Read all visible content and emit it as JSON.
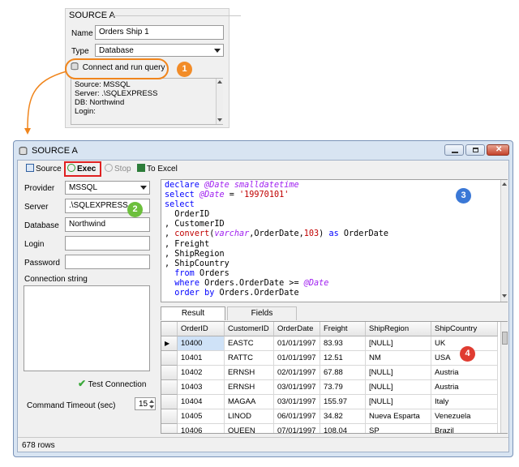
{
  "source_panel": {
    "title": "SOURCE A",
    "name_label": "Name",
    "name_value": "Orders Ship 1",
    "type_label": "Type",
    "type_value": "Database",
    "connect_button": "Connect and run query",
    "info_lines": [
      "Source: MSSQL",
      "Server: .\\SQLEXPRESS",
      "DB: Northwind",
      "Login:"
    ]
  },
  "window": {
    "title": "SOURCE A",
    "toolbar": {
      "source": "Source",
      "exec": "Exec",
      "stop": "Stop",
      "to_excel": "To Excel"
    },
    "left": {
      "provider_label": "Provider",
      "provider_value": "MSSQL",
      "server_label": "Server",
      "server_value": ".\\SQLEXPRESS",
      "database_label": "Database",
      "database_value": "Northwind",
      "login_label": "Login",
      "login_value": "",
      "password_label": "Password",
      "password_value": "",
      "conn_string_label": "Connection string",
      "conn_string_value": "",
      "test_connection": "Test Connection",
      "timeout_label": "Command Timeout (sec)",
      "timeout_value": "15"
    },
    "code_lines": [
      [
        {
          "t": "declare ",
          "c": "kw"
        },
        {
          "t": "@Date smalldatetime",
          "c": "vr"
        }
      ],
      [
        {
          "t": "select ",
          "c": "kw"
        },
        {
          "t": "@Date",
          "c": "vr"
        },
        {
          "t": " = ",
          "c": ""
        },
        {
          "t": "'19970101'",
          "c": "st"
        }
      ],
      [
        {
          "t": "select",
          "c": "kw"
        }
      ],
      [
        {
          "t": "  OrderID",
          "c": ""
        }
      ],
      [
        {
          "t": ", CustomerID",
          "c": ""
        }
      ],
      [
        {
          "t": ", ",
          "c": ""
        },
        {
          "t": "convert",
          "c": "fn"
        },
        {
          "t": "(",
          "c": ""
        },
        {
          "t": "varchar",
          "c": "ty"
        },
        {
          "t": ",OrderDate,",
          "c": ""
        },
        {
          "t": "103",
          "c": "st"
        },
        {
          "t": ") ",
          "c": ""
        },
        {
          "t": "as",
          "c": "kw"
        },
        {
          "t": " OrderDate",
          "c": ""
        }
      ],
      [
        {
          "t": ", Freight",
          "c": ""
        }
      ],
      [
        {
          "t": ", ShipRegion",
          "c": ""
        }
      ],
      [
        {
          "t": ", ShipCountry",
          "c": ""
        }
      ],
      [
        {
          "t": "  ",
          "c": ""
        },
        {
          "t": "from",
          "c": "kw"
        },
        {
          "t": " Orders",
          "c": ""
        }
      ],
      [
        {
          "t": "  ",
          "c": ""
        },
        {
          "t": "where",
          "c": "kw"
        },
        {
          "t": " Orders.OrderDate >= ",
          "c": ""
        },
        {
          "t": "@Date",
          "c": "vr"
        }
      ],
      [
        {
          "t": "  ",
          "c": ""
        },
        {
          "t": "order by",
          "c": "kw"
        },
        {
          "t": " Orders.OrderDate",
          "c": ""
        }
      ]
    ],
    "tabs": [
      "Result",
      "Fields"
    ],
    "grid": {
      "columns": [
        "OrderID",
        "CustomerID",
        "OrderDate",
        "Freight",
        "ShipRegion",
        "ShipCountry"
      ],
      "rows": [
        [
          "10400",
          "EASTC",
          "01/01/1997",
          "83.93",
          "[NULL]",
          "UK"
        ],
        [
          "10401",
          "RATTC",
          "01/01/1997",
          "12.51",
          "NM",
          "USA"
        ],
        [
          "10402",
          "ERNSH",
          "02/01/1997",
          "67.88",
          "[NULL]",
          "Austria"
        ],
        [
          "10403",
          "ERNSH",
          "03/01/1997",
          "73.79",
          "[NULL]",
          "Austria"
        ],
        [
          "10404",
          "MAGAA",
          "03/01/1997",
          "155.97",
          "[NULL]",
          "Italy"
        ],
        [
          "10405",
          "LINOD",
          "06/01/1997",
          "34.82",
          "Nueva Esparta",
          "Venezuela"
        ],
        [
          "10406",
          "QUEEN",
          "07/01/1997",
          "108.04",
          "SP",
          "Brazil"
        ]
      ]
    },
    "status": "678 rows"
  },
  "badges": [
    "1",
    "2",
    "3",
    "4"
  ],
  "colors": {
    "badge_orange": "#f28c28",
    "badge_green": "#6cbf3c",
    "badge_blue": "#3a78d6",
    "badge_red": "#e03c31",
    "callout_orange": "#f0851c",
    "exec_highlight": "#e02020",
    "selected_row": "#cfe2f7"
  }
}
